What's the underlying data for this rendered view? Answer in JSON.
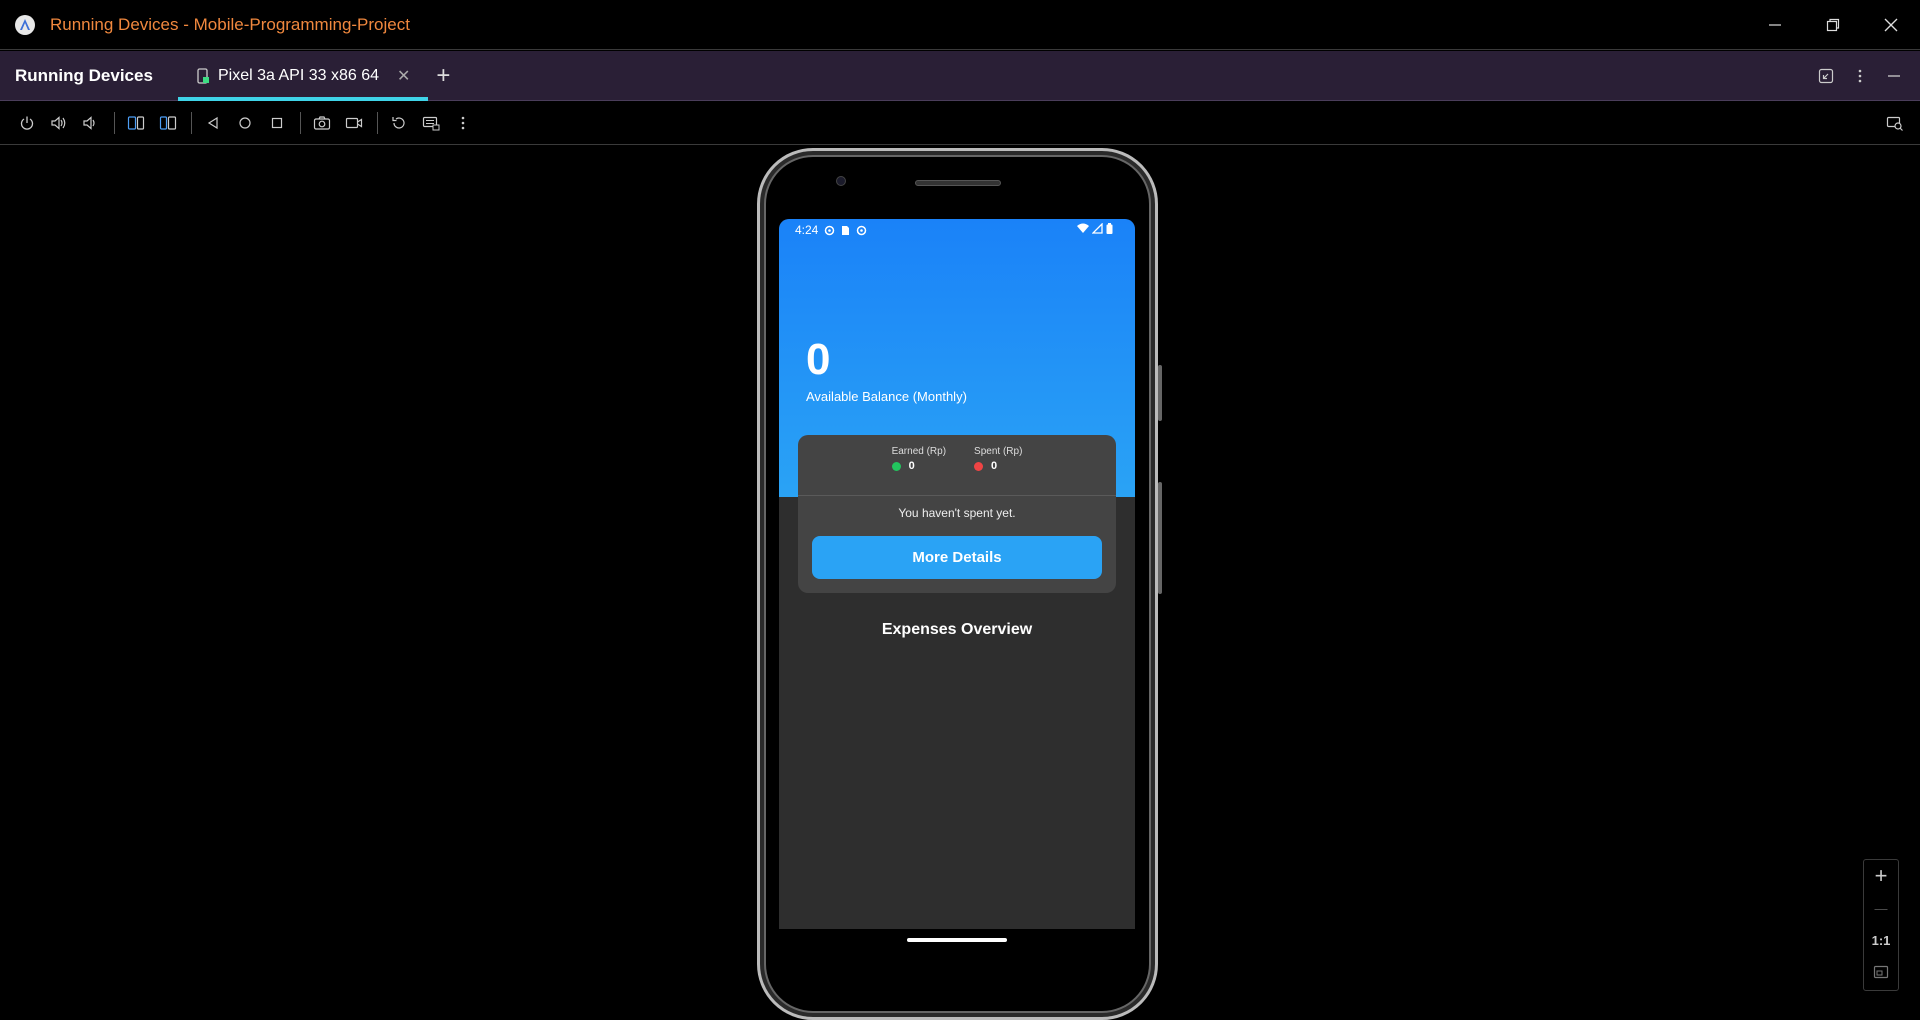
{
  "window": {
    "title": "Running Devices - Mobile-Programming-Project",
    "logo_icon": "android-studio-logo-icon",
    "controls": [
      "minimize-icon",
      "restore-icon",
      "close-icon"
    ]
  },
  "tool_window": {
    "title": "Running Devices",
    "tabs": [
      {
        "label": "Pixel 3a API 33 x86 64",
        "icon": "device-icon",
        "active": true
      }
    ],
    "right_icons": [
      "collapse-icon",
      "more-vertical-icon",
      "hide-icon"
    ]
  },
  "toolbar": {
    "buttons": [
      "power-icon",
      "volume-up-icon",
      "volume-down-icon",
      "rotate-left-icon",
      "rotate-right-icon",
      "back-icon",
      "home-icon",
      "overview-icon",
      "screenshot-icon",
      "screen-record-icon",
      "reset-icon",
      "keyboard-icon",
      "more-vertical-icon"
    ],
    "right_button": "device-mirror-icon"
  },
  "device": {
    "status_bar": {
      "time": "4:24"
    },
    "balance": {
      "amount": "0",
      "label": "Available Balance (Monthly)"
    },
    "summary": {
      "earned_label": "Earned (Rp)",
      "earned_value": "0",
      "earned_color": "#22c55e",
      "spent_label": "Spent (Rp)",
      "spent_value": "0",
      "spent_color": "#ef4444",
      "message": "You haven't spent yet.",
      "button_label": "More Details"
    },
    "section_title": "Expenses Overview",
    "accent_color": "#2aa3f5"
  },
  "zoom": {
    "zoom_in": "+",
    "zoom_out": "—",
    "actual_size": "1:1",
    "fit_icon": "fit-screen-icon"
  }
}
